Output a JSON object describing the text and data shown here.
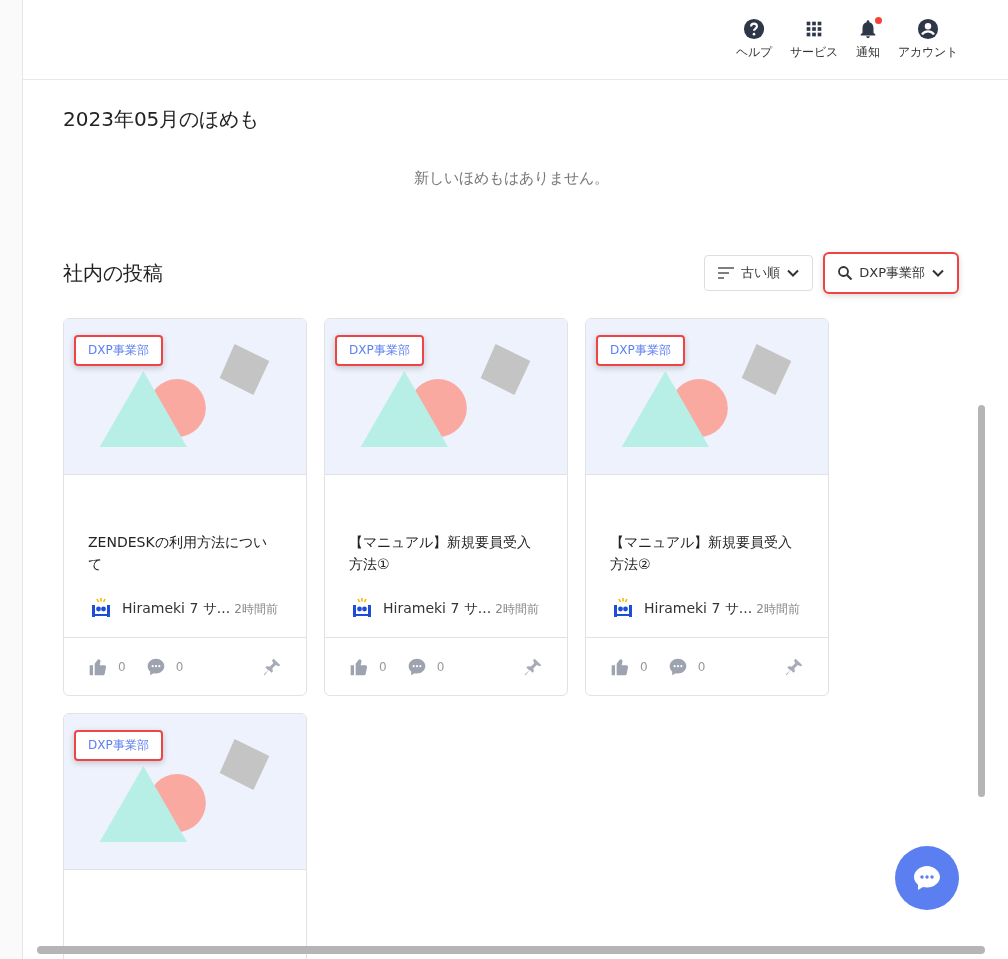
{
  "header": {
    "actions": [
      {
        "kind": "help",
        "label": "ヘルプ",
        "badge": false
      },
      {
        "kind": "apps",
        "label": "サービス",
        "badge": false
      },
      {
        "kind": "bell",
        "label": "通知",
        "badge": true
      },
      {
        "kind": "account",
        "label": "アカウント",
        "badge": false
      }
    ]
  },
  "praise": {
    "title": "2023年05月のほめも",
    "empty_message": "新しいほめもはありません。"
  },
  "posts": {
    "title": "社内の投稿",
    "sort": {
      "label": "古い順"
    },
    "filter": {
      "label": "DXP事業部"
    },
    "cards": [
      {
        "kind": "full",
        "tag": "DXP事業部",
        "title": "ZENDESKの利用方法について",
        "author": "Hirameki 7 サ...",
        "time": "2時間前",
        "likes": "0",
        "comments": "0",
        "pinned": false
      },
      {
        "kind": "full",
        "tag": "DXP事業部",
        "title": "【マニュアル】新規要員受入方法①",
        "author": "Hirameki 7 サ...",
        "time": "2時間前",
        "likes": "0",
        "comments": "0",
        "pinned": false
      },
      {
        "kind": "full",
        "tag": "DXP事業部",
        "title": "【マニュアル】新規要員受入方法②",
        "author": "Hirameki 7 サ...",
        "time": "2時間前",
        "likes": "0",
        "comments": "0",
        "pinned": false
      },
      {
        "kind": "partial",
        "tag": "DXP事業部"
      }
    ]
  }
}
